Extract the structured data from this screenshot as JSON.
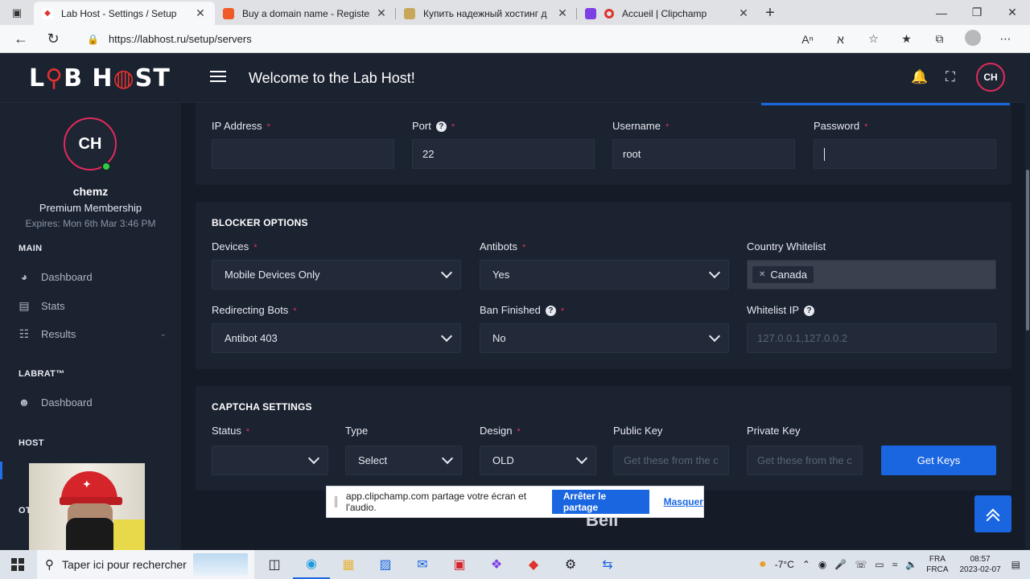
{
  "browser": {
    "tabs": [
      {
        "title": "Lab Host - Settings / Setup",
        "color": "#e0322f",
        "active": true
      },
      {
        "title": "Buy a domain name - Register ch",
        "color": "#f05a28",
        "active": false
      },
      {
        "title": "Купить надежный хостинг д",
        "color": "#c8a75a",
        "active": false
      },
      {
        "title": "Accueil | Clipchamp",
        "color": "#7b3fe4",
        "active": false
      }
    ],
    "url": "https://labhost.ru/setup/servers"
  },
  "header": {
    "logo_left": "L",
    "logo_flask": "⚲",
    "logo_mid": "B H",
    "logo_globe": "◍",
    "logo_right": "ST",
    "title": "Welcome to the Lab Host!",
    "avatar": "CH"
  },
  "sidebar": {
    "avatar": "CH",
    "name": "chemz",
    "membership": "Premium Membership",
    "expires": "Expires: Mon 6th Mar 3:46 PM",
    "sections": {
      "main": "MAIN",
      "labrat": "LABRAT™",
      "host": "HOST",
      "other": "OT"
    },
    "items": {
      "dashboard": "Dashboard",
      "stats": "Stats",
      "results": "Results",
      "labrat_dashboard": "Dashboard"
    }
  },
  "server": {
    "ip_label": "IP Address",
    "ip_value": "",
    "port_label": "Port",
    "port_value": "22",
    "username_label": "Username",
    "username_value": "root",
    "password_label": "Password"
  },
  "blocker": {
    "title": "BLOCKER OPTIONS",
    "devices_label": "Devices",
    "devices_value": "Mobile Devices Only",
    "antibots_label": "Antibots",
    "antibots_value": "Yes",
    "whitelist_label": "Country Whitelist",
    "whitelist_tag": "Canada",
    "redirecting_label": "Redirecting Bots",
    "redirecting_value": "Antibot 403",
    "ban_label": "Ban Finished",
    "ban_value": "No",
    "whitelist_ip_label": "Whitelist IP",
    "whitelist_ip_placeholder": "127.0.0.1,127.0.0.2"
  },
  "captcha": {
    "title": "CAPTCHA SETTINGS",
    "status_label": "Status",
    "status_value": "",
    "type_label": "Type",
    "type_value": "Select",
    "design_label": "Design",
    "design_value": "OLD",
    "public_key_label": "Public Key",
    "public_key_placeholder": "Get these from the c",
    "private_key_label": "Private Key",
    "private_key_placeholder": "Get these from the c",
    "get_keys_label": "Get Keys"
  },
  "below_text": "Bell",
  "sharebar": {
    "message": "app.clipchamp.com partage votre écran et l'audio.",
    "stop_label": "Arrêter le partage",
    "hide_label": "Masquer"
  },
  "taskbar": {
    "search_placeholder": "Taper ici pour rechercher",
    "weather": "-7°C",
    "lang_top": "FRA",
    "lang_bottom": "FRCA",
    "time": "08:57",
    "date": "2023-02-07"
  },
  "colors": {
    "accent": "#1a66e0",
    "required": "#e0325a",
    "online": "#2ecc40"
  }
}
